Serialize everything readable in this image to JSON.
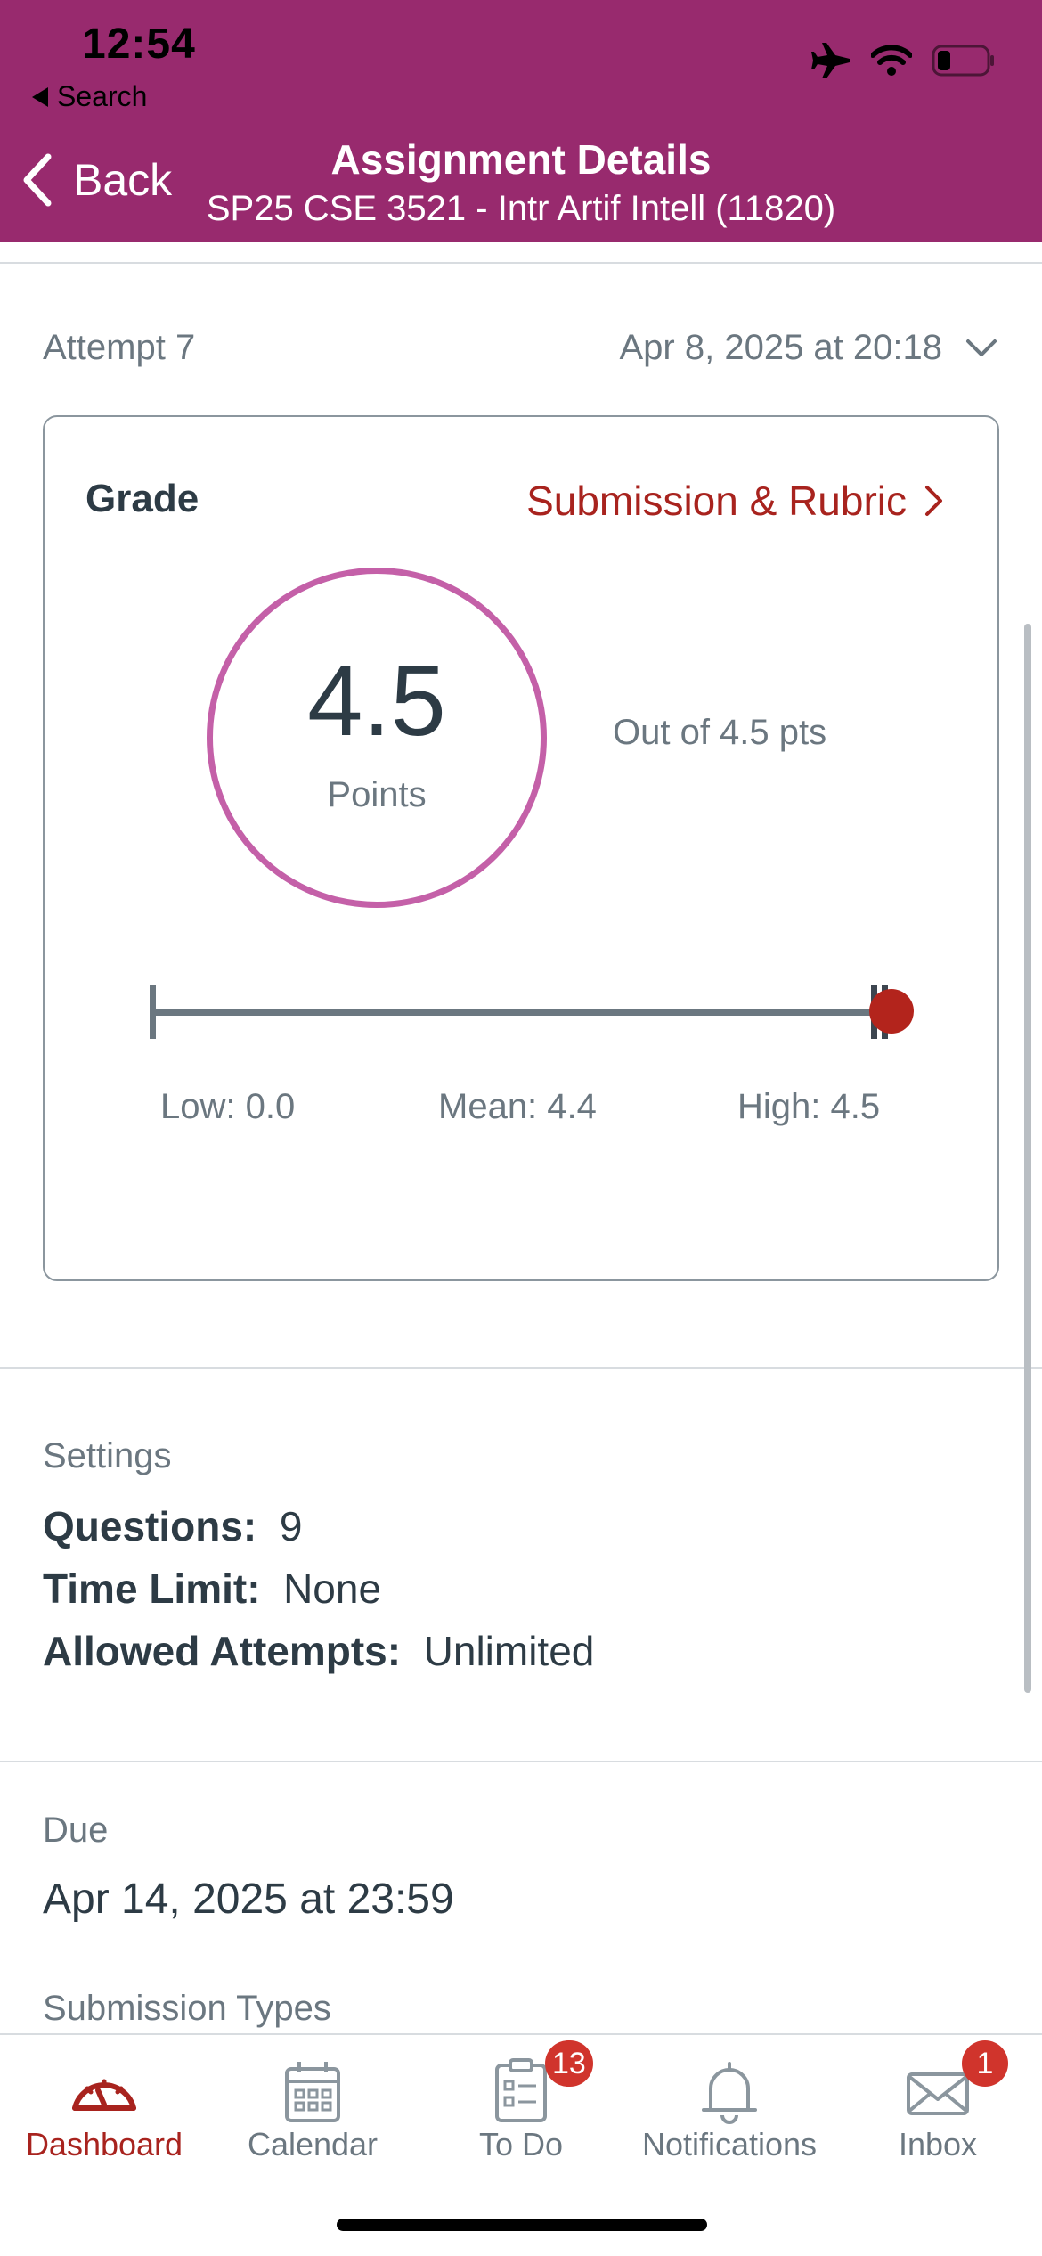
{
  "status_bar": {
    "time": "12:54",
    "back_app": "Search"
  },
  "nav": {
    "back_label": "Back",
    "title": "Assignment Details",
    "subtitle": "SP25 CSE 3521 - Intr Artif Intell (11820)"
  },
  "attempt": {
    "label": "Attempt 7",
    "date": "Apr 8, 2025 at 20:18"
  },
  "grade": {
    "title": "Grade",
    "rubric_link": "Submission & Rubric",
    "score": "4.5",
    "score_unit": "Points",
    "out_of": "Out of 4.5 pts",
    "low": "Low: 0.0",
    "mean": "Mean: 4.4",
    "high": "High: 4.5"
  },
  "settings": {
    "label": "Settings",
    "rows": [
      {
        "key": "Questions:",
        "value": "9"
      },
      {
        "key": "Time Limit:",
        "value": "None"
      },
      {
        "key": "Allowed Attempts:",
        "value": "Unlimited"
      }
    ]
  },
  "due": {
    "label": "Due",
    "value": "Apr 14, 2025 at 23:59"
  },
  "submission_types": {
    "label": "Submission Types"
  },
  "tabs": [
    {
      "label": "Dashboard",
      "icon": "dashboard-icon",
      "active": true
    },
    {
      "label": "Calendar",
      "icon": "calendar-icon"
    },
    {
      "label": "To Do",
      "icon": "todo-icon",
      "badge": "13"
    },
    {
      "label": "Notifications",
      "icon": "bell-icon"
    },
    {
      "label": "Inbox",
      "icon": "mail-icon",
      "badge": "1"
    }
  ],
  "colors": {
    "header": "#982a6e",
    "accent": "#a8231e",
    "circle": "#c460a8",
    "badge": "#d0342c"
  }
}
